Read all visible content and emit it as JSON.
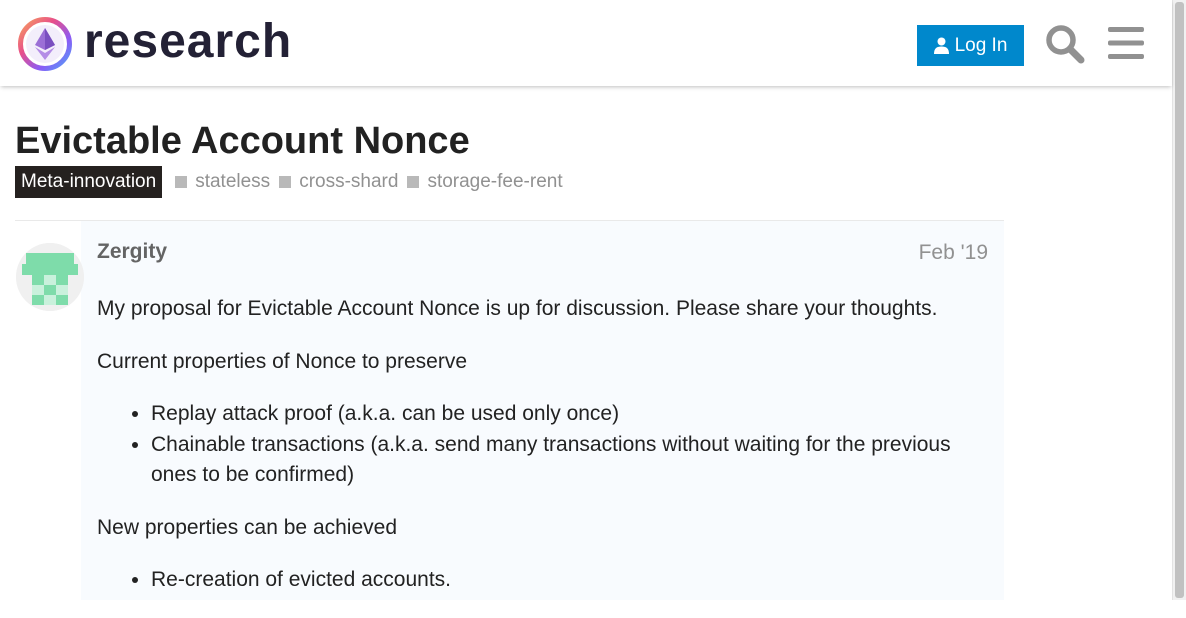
{
  "header": {
    "site_name": "research",
    "login_label": "Log In",
    "icons": [
      "logo-icon",
      "user-icon",
      "search-icon",
      "menu-icon"
    ],
    "accent_color": "#0088cc"
  },
  "topic": {
    "title": "Evictable Account Nonce",
    "category": "Meta-innovation",
    "category_color": "#25211f",
    "tags": [
      "stateless",
      "cross-shard",
      "storage-fee-rent"
    ]
  },
  "post": {
    "username": "Zergity",
    "date": "Feb '19",
    "paragraph_1": "My proposal for Evictable Account Nonce is up for discussion. Please share your thoughts.",
    "paragraph_2": "Current properties of Nonce to preserve",
    "list_1": [
      "Replay attack proof (a.k.a. can be used only once)",
      "Chainable transactions (a.k.a. send many transactions without waiting for the previous ones to be confirmed)"
    ],
    "paragraph_3": "New properties can be achieved",
    "list_2": [
      "Re-creation of evicted accounts."
    ]
  }
}
